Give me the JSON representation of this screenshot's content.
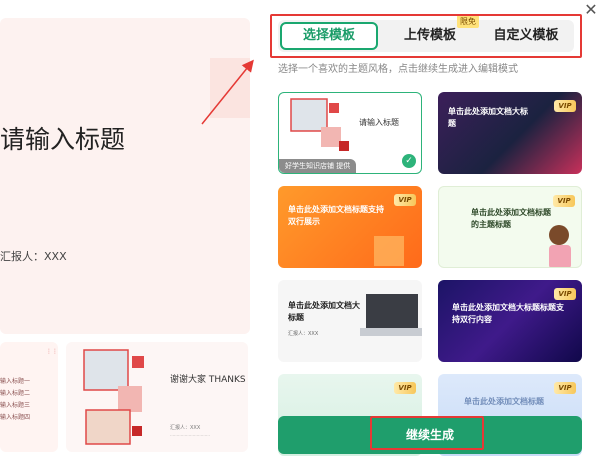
{
  "preview": {
    "main_title": "请输入标题",
    "reporter": "汇报人：XXX",
    "toc_items": [
      "输入标题一",
      "输入标题二",
      "输入标题三",
      "输入标题四"
    ],
    "thumb_dots": "⋮⋮⋮",
    "thanks_text": "谢谢大家 THANKS",
    "thanks_info": "汇报人：XXX"
  },
  "dialog": {
    "close_icon": "close-icon",
    "tabs": [
      {
        "label": "选择模板",
        "active": true
      },
      {
        "label": "上传模板",
        "badge": "限免"
      },
      {
        "label": "自定义模板"
      }
    ],
    "hint": "选择一个喜欢的主题风格，点击继续生成进入编辑模式",
    "templates": [
      {
        "title": "请输入标题",
        "credit": "好学生知识店铺 提供",
        "selected": true
      },
      {
        "title": "单击此处添加文档大标题",
        "vip": "VIP"
      },
      {
        "title": "单击此处添加文档标题支持双行展示",
        "vip": "VIP"
      },
      {
        "title": "单击此处添加文档标题的主题标题",
        "vip": "VIP"
      },
      {
        "title": "单击此处添加文档大标题",
        "subtitle": "汇报人：XXX"
      },
      {
        "title": "单击此处添加文档大标题标题支持双行内容",
        "vip": "VIP"
      },
      {
        "title": "",
        "vip": "VIP"
      },
      {
        "title": "单击此处添加文档标题",
        "vip": "VIP"
      }
    ],
    "generate_label": "继续生成",
    "accent_color": "#1f9e6c",
    "highlight_color": "#e53935"
  }
}
